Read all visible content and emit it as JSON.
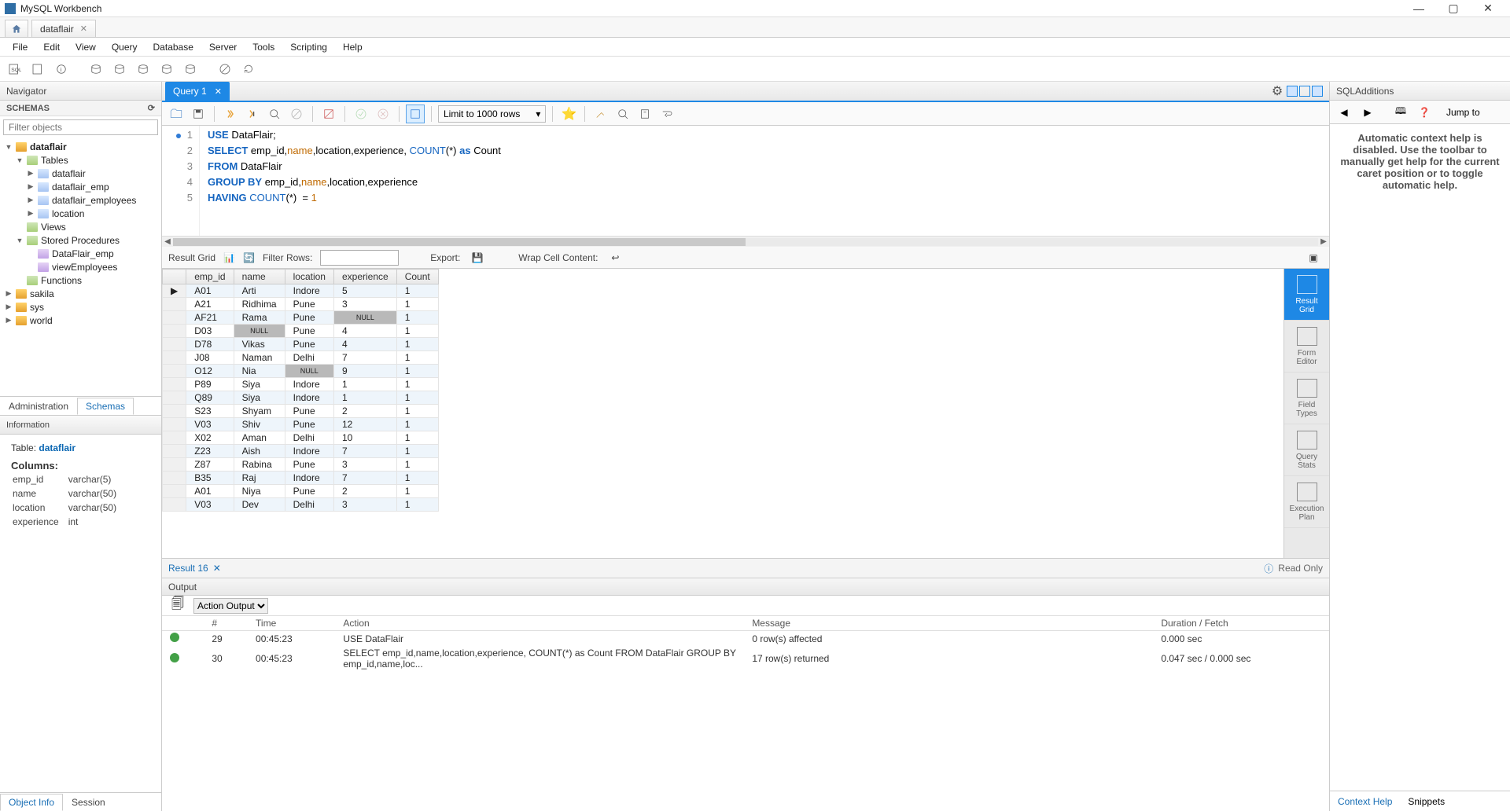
{
  "titlebar": {
    "title": "MySQL Workbench"
  },
  "conn_tab": {
    "label": "dataflair"
  },
  "menu": [
    "File",
    "Edit",
    "View",
    "Query",
    "Database",
    "Server",
    "Tools",
    "Scripting",
    "Help"
  ],
  "navigator": {
    "header": "Navigator",
    "schemas_label": "SCHEMAS",
    "filter_placeholder": "Filter objects"
  },
  "tree": {
    "db": "dataflair",
    "tables_label": "Tables",
    "tables": [
      "dataflair",
      "dataflair_emp",
      "dataflair_employees",
      "location"
    ],
    "views_label": "Views",
    "sproc_label": "Stored Procedures",
    "sprocs": [
      "DataFlair_emp",
      "viewEmployees"
    ],
    "functions_label": "Functions",
    "other_dbs": [
      "sakila",
      "sys",
      "world"
    ]
  },
  "nav_tabs": {
    "admin": "Administration",
    "schemas": "Schemas"
  },
  "info": {
    "header": "Information",
    "table_label": "Table:",
    "table_name": "dataflair",
    "columns_label": "Columns:",
    "cols": [
      {
        "n": "emp_id",
        "t": "varchar(5)"
      },
      {
        "n": "name",
        "t": "varchar(50)"
      },
      {
        "n": "location",
        "t": "varchar(50)"
      },
      {
        "n": "experience",
        "t": "int"
      }
    ]
  },
  "nav_bottom": {
    "objinfo": "Object Info",
    "session": "Session"
  },
  "query_tab": "Query 1",
  "limit_combo": "Limit to 1000 rows",
  "code_lines": [
    [
      {
        "t": "USE",
        "c": "kw"
      },
      {
        "t": " DataFlair;",
        "c": ""
      }
    ],
    [
      {
        "t": "SELECT",
        "c": "kw"
      },
      {
        "t": " emp_id,",
        "c": ""
      },
      {
        "t": "name",
        "c": "id"
      },
      {
        "t": ",location,experience, ",
        "c": ""
      },
      {
        "t": "COUNT",
        "c": "fn"
      },
      {
        "t": "(*) ",
        "c": ""
      },
      {
        "t": "as",
        "c": "kw"
      },
      {
        "t": " Count",
        "c": ""
      }
    ],
    [
      {
        "t": "FROM",
        "c": "kw"
      },
      {
        "t": " DataFlair",
        "c": ""
      }
    ],
    [
      {
        "t": "GROUP BY",
        "c": "kw"
      },
      {
        "t": " emp_id,",
        "c": ""
      },
      {
        "t": "name",
        "c": "id"
      },
      {
        "t": ",location,experience",
        "c": ""
      }
    ],
    [
      {
        "t": "HAVING",
        "c": "kw"
      },
      {
        "t": " ",
        "c": ""
      },
      {
        "t": "COUNT",
        "c": "fn"
      },
      {
        "t": "(*)  = ",
        "c": ""
      },
      {
        "t": "1",
        "c": "num"
      }
    ]
  ],
  "gridbar": {
    "label": "Result Grid",
    "filter": "Filter Rows:",
    "export": "Export:",
    "wrap": "Wrap Cell Content:"
  },
  "grid": {
    "headers": [
      "emp_id",
      "name",
      "location",
      "experience",
      "Count"
    ],
    "rows": [
      [
        "A01",
        "Arti",
        "Indore",
        "5",
        "1"
      ],
      [
        "A21",
        "Ridhima",
        "Pune",
        "3",
        "1"
      ],
      [
        "AF21",
        "Rama",
        "Pune",
        null,
        "1"
      ],
      [
        "D03",
        null,
        "Pune",
        "4",
        "1"
      ],
      [
        "D78",
        "Vikas",
        "Pune",
        "4",
        "1"
      ],
      [
        "J08",
        "Naman",
        "Delhi",
        "7",
        "1"
      ],
      [
        "O12",
        "Nia",
        null,
        "9",
        "1"
      ],
      [
        "P89",
        "Siya",
        "Indore",
        "1",
        "1"
      ],
      [
        "Q89",
        "Siya",
        "Indore",
        "1",
        "1"
      ],
      [
        "S23",
        "Shyam",
        "Pune",
        "2",
        "1"
      ],
      [
        "V03",
        "Shiv",
        "Pune",
        "12",
        "1"
      ],
      [
        "X02",
        "Aman",
        "Delhi",
        "10",
        "1"
      ],
      [
        "Z23",
        "Aish",
        "Indore",
        "7",
        "1"
      ],
      [
        "Z87",
        "Rabina",
        "Pune",
        "3",
        "1"
      ],
      [
        "B35",
        "Raj",
        "Indore",
        "7",
        "1"
      ],
      [
        "A01",
        "Niya",
        "Pune",
        "2",
        "1"
      ],
      [
        "V03",
        "Dev",
        "Delhi",
        "3",
        "1"
      ]
    ]
  },
  "side_tabs": [
    "Result Grid",
    "Form Editor",
    "Field Types",
    "Query Stats",
    "Execution Plan"
  ],
  "result_tab": "Result 16",
  "readonly": "Read Only",
  "output": {
    "header": "Output",
    "selector": "Action Output",
    "cols": [
      "",
      "#",
      "Time",
      "Action",
      "Message",
      "Duration / Fetch"
    ],
    "rows": [
      {
        "n": "29",
        "time": "00:45:23",
        "action": "USE DataFlair",
        "msg": "0 row(s) affected",
        "dur": "0.000 sec"
      },
      {
        "n": "30",
        "time": "00:45:23",
        "action": "SELECT emp_id,name,location,experience, COUNT(*) as Count FROM DataFlair GROUP BY emp_id,name,loc...",
        "msg": "17 row(s) returned",
        "dur": "0.047 sec / 0.000 sec"
      }
    ]
  },
  "right": {
    "header": "SQLAdditions",
    "jump": "Jump to",
    "body": "Automatic context help is disabled. Use the toolbar to manually get help for the current caret position or to toggle automatic help.",
    "tabs": {
      "ctx": "Context Help",
      "snip": "Snippets"
    }
  }
}
